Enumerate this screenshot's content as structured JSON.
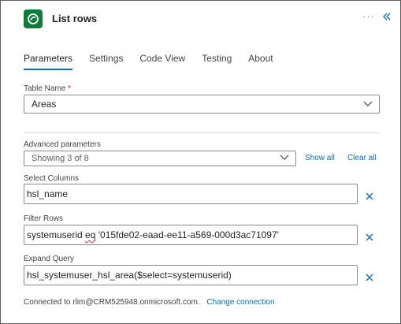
{
  "header": {
    "title": "List rows",
    "more_icon": "more-horizontal-icon",
    "collapse_icon": "chevron-double-left-icon",
    "app_icon": "dataverse-icon"
  },
  "tabs": [
    {
      "label": "Parameters",
      "active": true
    },
    {
      "label": "Settings",
      "active": false
    },
    {
      "label": "Code View",
      "active": false
    },
    {
      "label": "Testing",
      "active": false
    },
    {
      "label": "About",
      "active": false
    }
  ],
  "table_name": {
    "label": "Table Name",
    "required_mark": "*",
    "value": "Areas"
  },
  "advanced": {
    "label": "Advanced parameters",
    "value": "Showing 3 of 8",
    "show_all": "Show all",
    "clear_all": "Clear all"
  },
  "select_columns": {
    "label": "Select Columns",
    "value": "hsl_name"
  },
  "filter_rows": {
    "label": "Filter Rows",
    "value_part1": "systemuserid",
    "value_part2": " ",
    "value_part3": "eq",
    "value_part4": " '015fde02-eaad-ee11-a569-000d3ac71097'"
  },
  "expand_query": {
    "label": "Expand Query",
    "value": "hsl_systemuser_hsl_area($select=systemuserid)"
  },
  "footer": {
    "connected_text": "Connected to rlim@CRM525948.onmicrosoft.com.",
    "change_connection": "Change connection"
  },
  "colors": {
    "accent": "#0f6cbd",
    "app_icon_bg": "#0e7c3a",
    "required": "#c50f1f",
    "spellcheck": "#d13438"
  }
}
